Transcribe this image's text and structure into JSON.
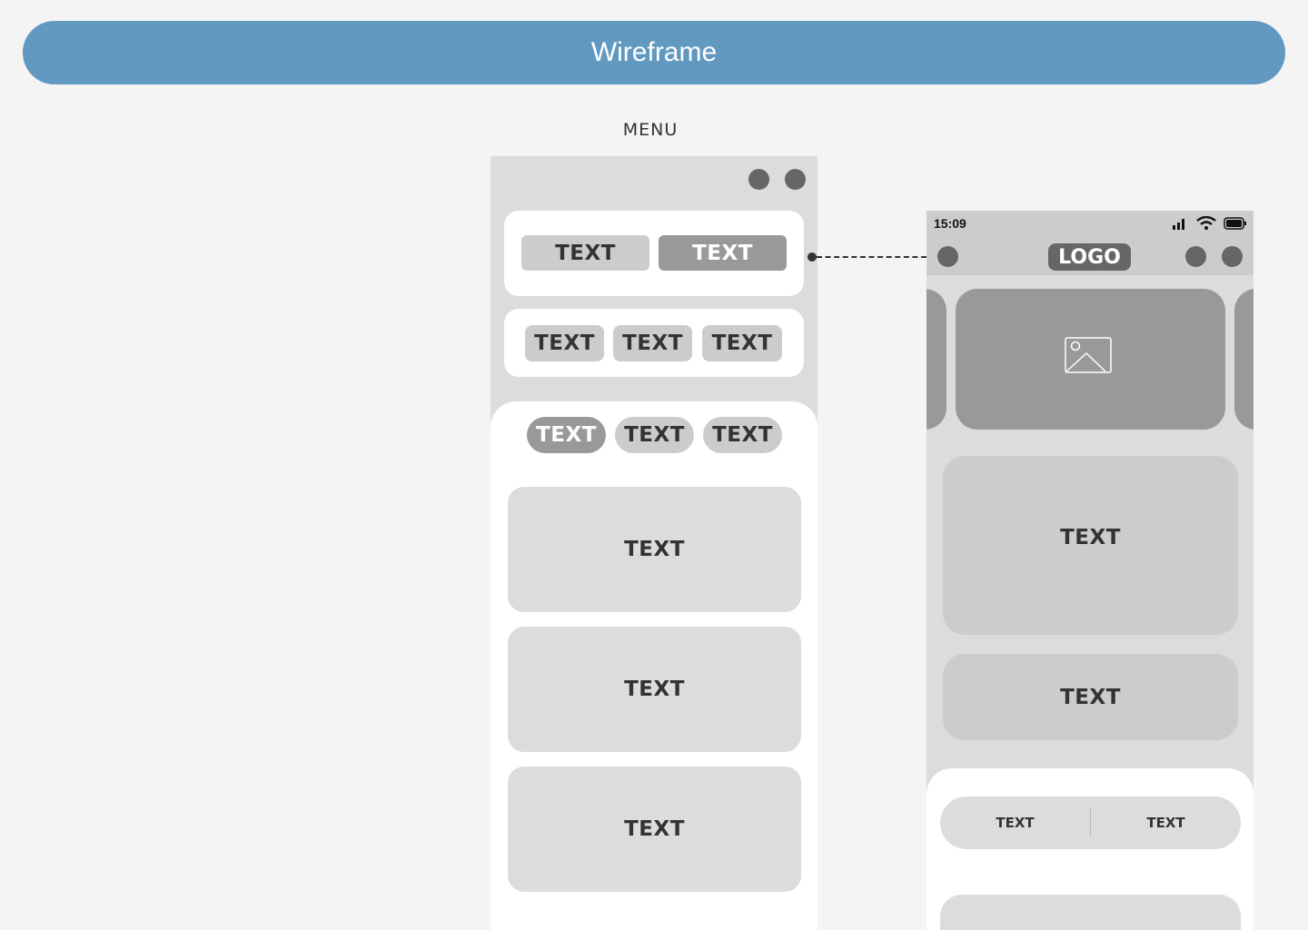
{
  "banner": {
    "title": "Wireframe"
  },
  "menu_frame": {
    "label": "MENU",
    "toggle_pills": [
      {
        "label": "TEXT",
        "state": "inactive"
      },
      {
        "label": "TEXT",
        "state": "active"
      }
    ],
    "filter_pills": [
      {
        "label": "TEXT"
      },
      {
        "label": "TEXT"
      },
      {
        "label": "TEXT"
      }
    ],
    "sheet_tabs": [
      {
        "label": "TEXT",
        "state": "active"
      },
      {
        "label": "TEXT",
        "state": "inactive"
      },
      {
        "label": "TEXT",
        "state": "inactive"
      }
    ],
    "cards": [
      {
        "label": "TEXT"
      },
      {
        "label": "TEXT"
      },
      {
        "label": "TEXT"
      }
    ]
  },
  "home_frame": {
    "status_time": "15:09",
    "logo": "LOGO",
    "card_large": "TEXT",
    "card_medium": "TEXT",
    "segment": [
      "TEXT",
      "TEXT"
    ]
  },
  "colors": {
    "banner": "#6299c0",
    "dark_gray": "#666666",
    "mid_gray": "#999999",
    "light_gray": "#cccccc",
    "frame_bg": "#dcdcdc"
  }
}
